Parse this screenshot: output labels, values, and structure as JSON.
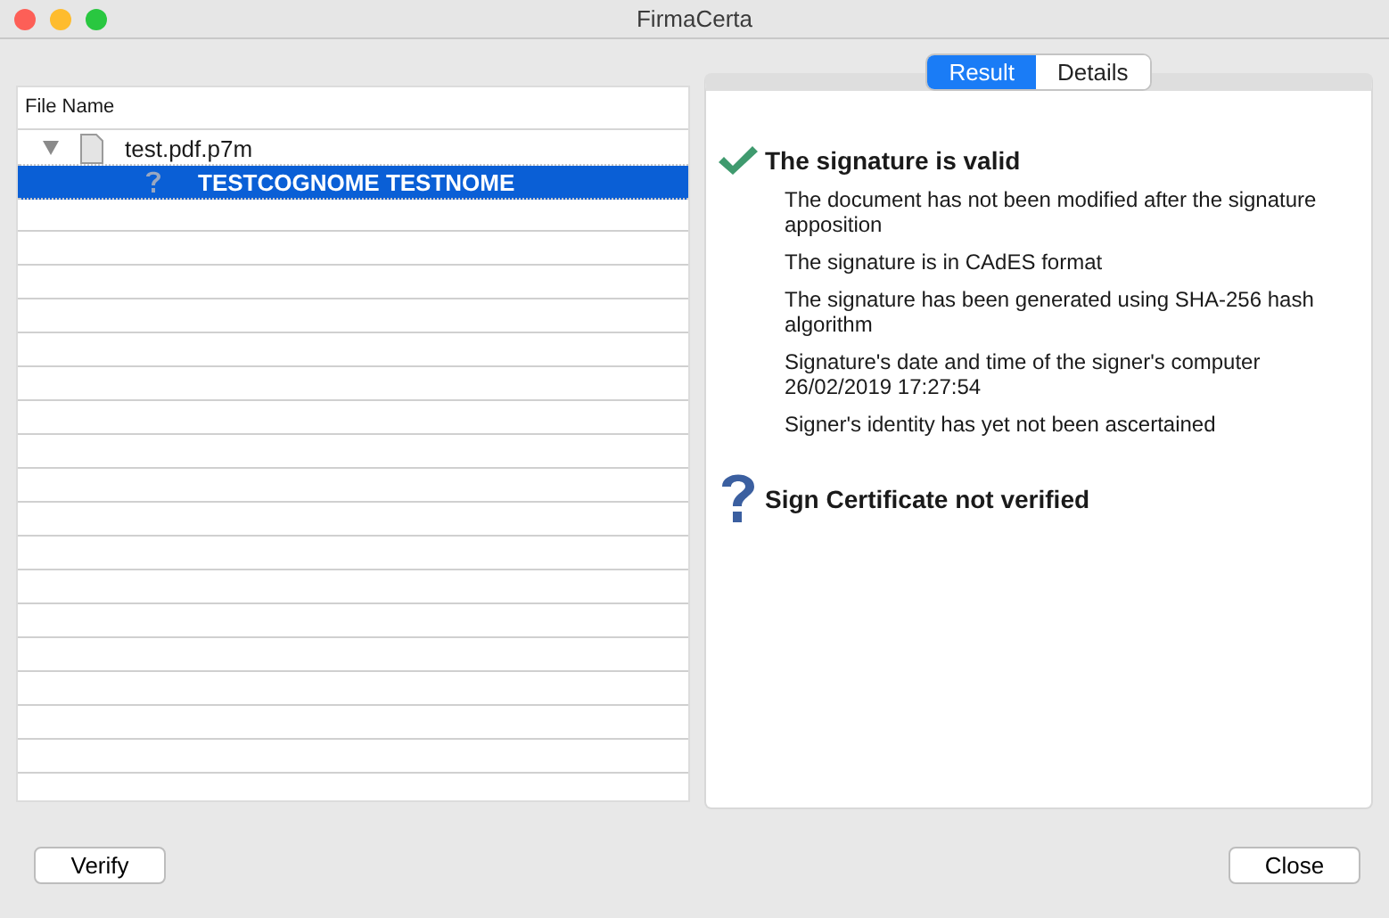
{
  "window": {
    "title": "FirmaCerta"
  },
  "file_list": {
    "column_header": "File Name",
    "tree": [
      {
        "label": "test.pdf.p7m",
        "kind": "file",
        "expanded": true,
        "selected": false,
        "children": [
          {
            "label": "TESTCOGNOME TESTNOME",
            "kind": "signer",
            "selected": true
          }
        ]
      }
    ]
  },
  "tabs": [
    {
      "label": "Result",
      "selected": true
    },
    {
      "label": "Details",
      "selected": false
    }
  ],
  "results": [
    {
      "kind": "valid",
      "title": "The signature is valid",
      "details": [
        "The document has not been modified after the signature apposition",
        "The signature is in CAdES format",
        "The signature has been generated using SHA-256 hash algorithm",
        "Signature's date and time of the signer's computer 26/02/2019 17:27:54",
        "Signer's identity has yet not been ascertained"
      ]
    },
    {
      "kind": "unknown",
      "title": "Sign Certificate not verified"
    }
  ],
  "buttons": {
    "left": "Verify",
    "right": "Close"
  }
}
